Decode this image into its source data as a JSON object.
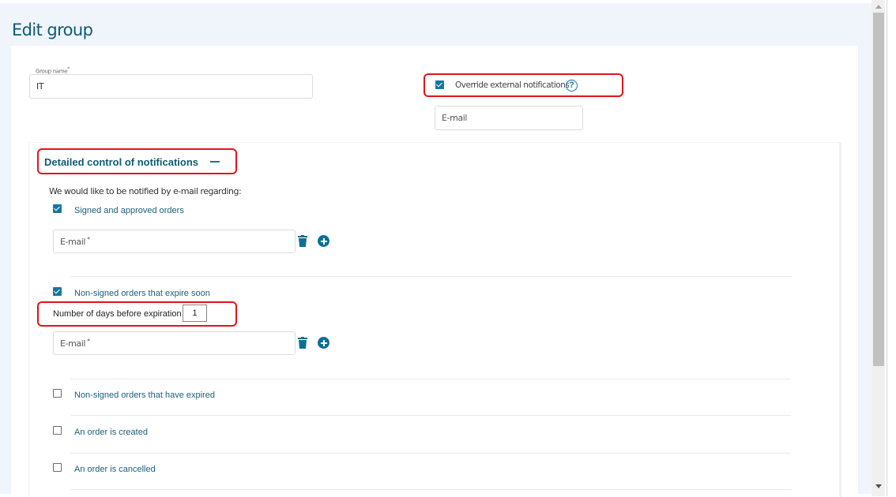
{
  "page": {
    "title": "Edit group"
  },
  "group_name": {
    "label": "Group name",
    "required_mark": "*",
    "value": "IT"
  },
  "override": {
    "label": "Override external notifications",
    "checked": true,
    "help_icon": "question-circle-icon"
  },
  "override_email": {
    "placeholder": "E-mail"
  },
  "detailed": {
    "title": "Detailed control of notifications",
    "toggle_icon": "minus-icon",
    "intro": "We would like to be notified by e-mail regarding:",
    "options": [
      {
        "label": "Signed and approved orders",
        "checked": true
      },
      {
        "label": "Non-signed orders that expire soon",
        "checked": true
      },
      {
        "label": "Non-signed orders that have expired",
        "checked": false
      },
      {
        "label": "An order is created",
        "checked": false
      },
      {
        "label": "An order is cancelled",
        "checked": false
      }
    ],
    "email_field": {
      "placeholder": "E-mail",
      "required_mark": "*"
    },
    "days": {
      "label": "Number of days before expiration",
      "value": "1"
    }
  },
  "colors": {
    "accent": "#1776a0",
    "title": "#0d5c73",
    "highlight": "#e0141c",
    "background": "#f0f4fb"
  }
}
